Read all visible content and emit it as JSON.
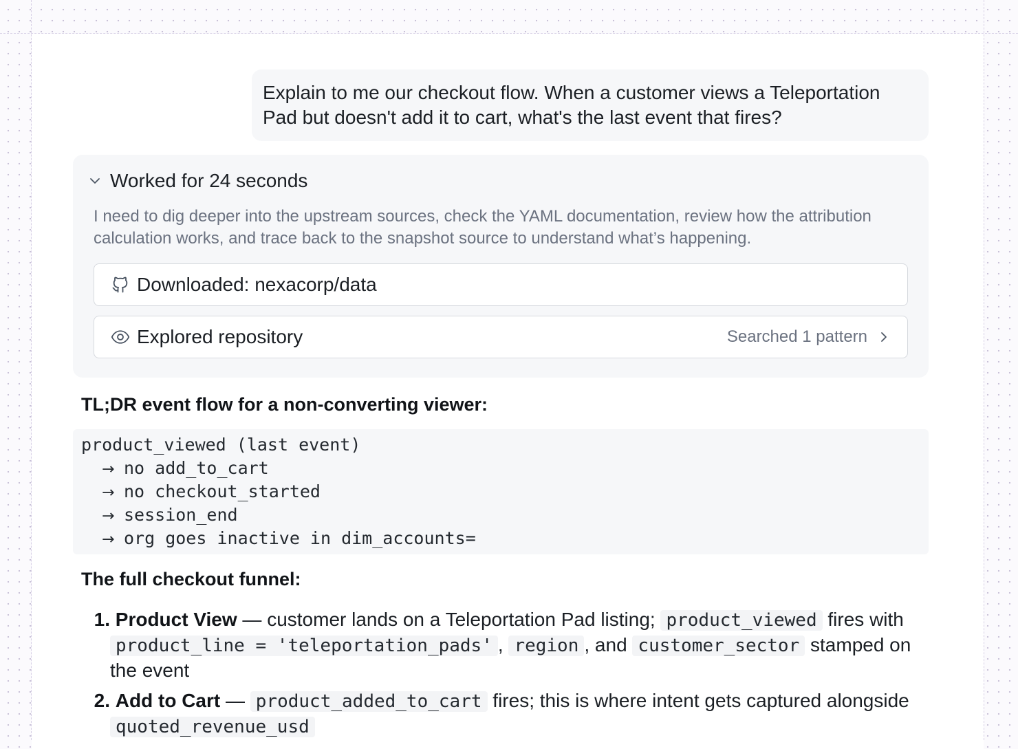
{
  "user_message": {
    "text": "Explain to me our checkout flow. When a customer views a Teleportation Pad but doesn't add it to cart, what's the last event that fires?"
  },
  "work_summary": {
    "title": "Worked for 24 seconds",
    "description": "I need to dig deeper into the upstream sources, check the YAML documentation, review how the attribution calculation works, and trace back to the snapshot source to understand what’s happening.",
    "steps": [
      {
        "icon": "github-icon",
        "label": "Downloaded: nexacorp/data"
      },
      {
        "icon": "eye-icon",
        "label": "Explored repository",
        "meta": "Searched 1 pattern"
      }
    ]
  },
  "tldr": {
    "heading": "TL;DR event flow for a non-converting viewer:",
    "first_line": "product_viewed (last event)",
    "arrow_glyph": "→",
    "steps": [
      "no add_to_cart",
      "no checkout_started",
      "session_end",
      "org goes inactive in dim_accounts="
    ]
  },
  "funnel": {
    "heading": "The full checkout funnel:",
    "items": [
      {
        "number": "1.",
        "title": "Product View",
        "dash": " — ",
        "text_a": "customer lands on a Teleportation Pad listing; ",
        "code_a": "product_viewed",
        "text_b": " fires with ",
        "code_b": "product_line = 'teleportation_pads'",
        "text_c": ", ",
        "code_c": "region",
        "text_d": ", and ",
        "code_d": "customer_sector",
        "text_e": " stamped on the event"
      },
      {
        "number": "2.",
        "title": "Add to Cart",
        "dash": " — ",
        "code_a": "product_added_to_cart",
        "text_b": " fires; this is where intent gets captured alongside ",
        "code_b": "quoted_revenue_usd"
      }
    ]
  },
  "colors": {
    "panel_bg": "#ffffff",
    "card_bg": "#f6f7f9",
    "muted_text": "#6b7280",
    "border": "#d6d9de"
  }
}
